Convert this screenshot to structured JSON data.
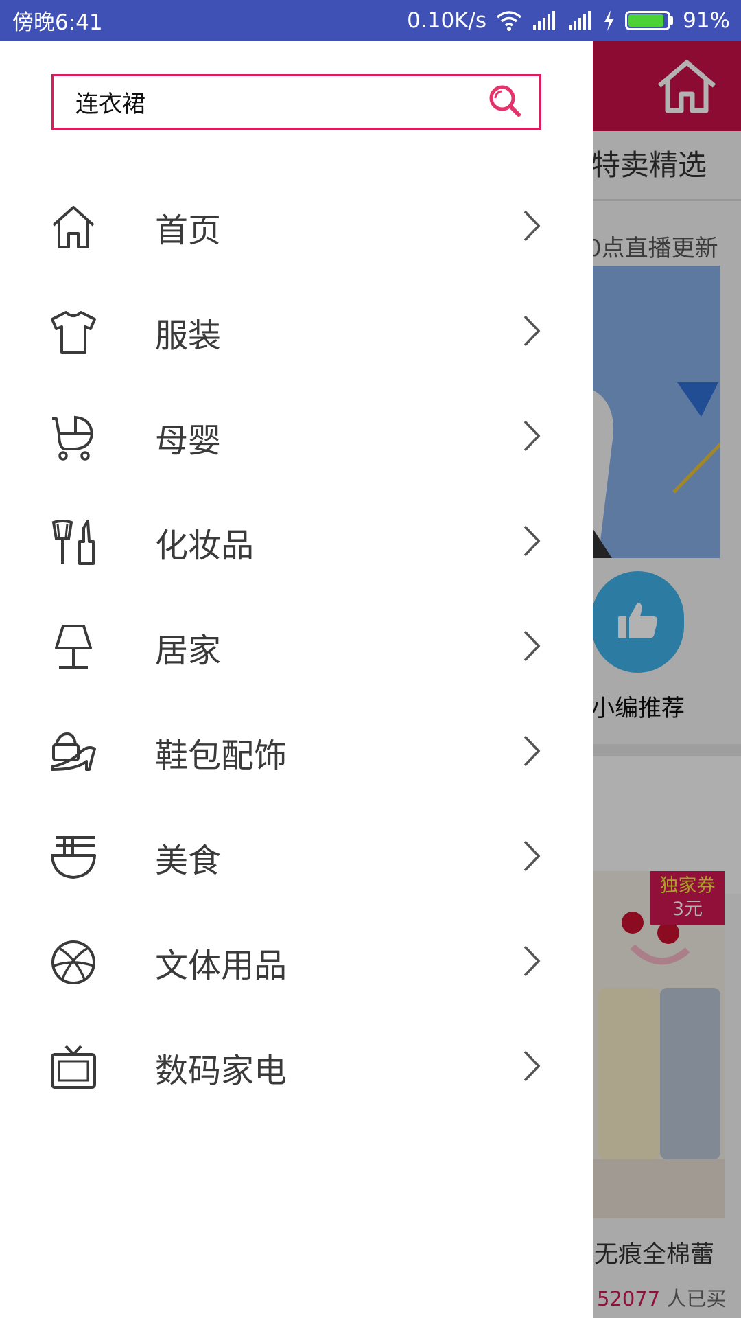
{
  "status_bar": {
    "time": "傍晚6:41",
    "network_speed": "0.10K/s",
    "battery_percent": "91%",
    "battery_level": 0.91,
    "icons": [
      "wifi-icon",
      "signal-icon",
      "signal-icon",
      "charging-icon",
      "battery-icon"
    ]
  },
  "drawer": {
    "search": {
      "value": "连衣裙",
      "accent_color": "#d81e5b"
    },
    "menu_items": [
      {
        "label": "首页",
        "icon": "home-icon"
      },
      {
        "label": "服装",
        "icon": "tshirt-icon"
      },
      {
        "label": "母婴",
        "icon": "stroller-icon"
      },
      {
        "label": "化妆品",
        "icon": "cosmetics-icon"
      },
      {
        "label": "居家",
        "icon": "lamp-icon"
      },
      {
        "label": "鞋包配饰",
        "icon": "shoe-bag-icon"
      },
      {
        "label": "美食",
        "icon": "noodle-bowl-icon"
      },
      {
        "label": "文体用品",
        "icon": "basketball-icon"
      },
      {
        "label": "数码家电",
        "icon": "tv-icon"
      }
    ]
  },
  "background_page": {
    "header_color": "#c8104a",
    "section_title": "特卖精选",
    "live_update_text": "0点直播更新",
    "recommend_label": "小编推荐",
    "coupon": {
      "title": "独家券",
      "amount": "3元"
    },
    "product_name": "无痕全棉蕾",
    "sold_count": "52077",
    "sold_suffix": "人已买"
  }
}
